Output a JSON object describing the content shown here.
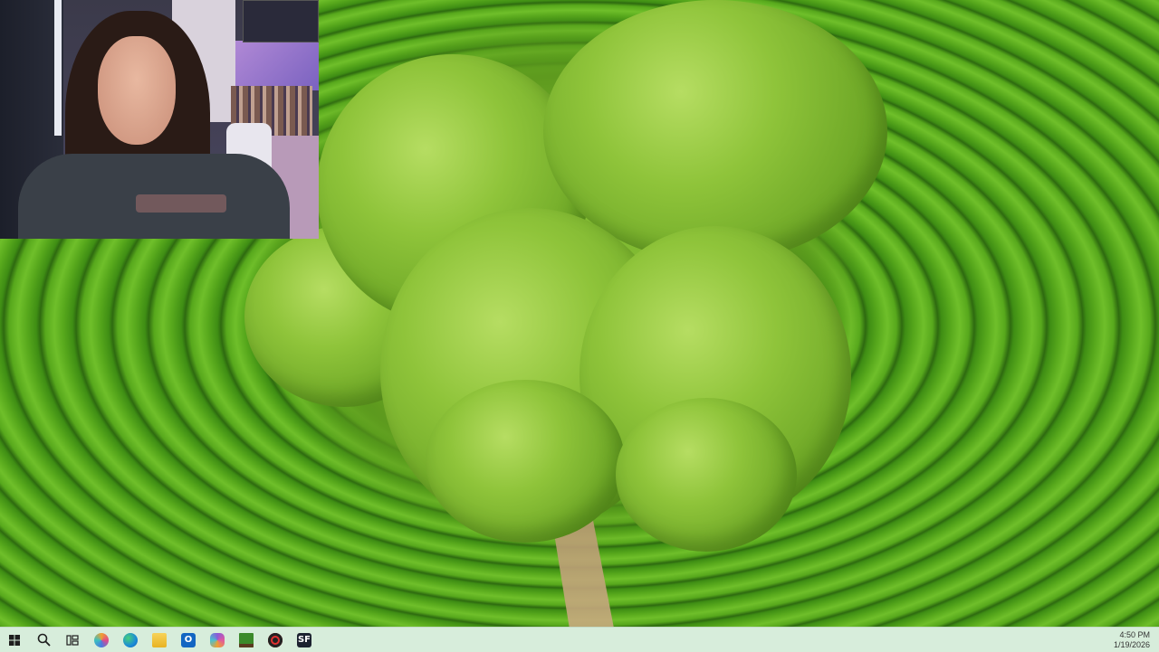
{
  "taskbar": {
    "time": "4:50 PM",
    "date": "1/19/2026",
    "apps": [
      {
        "name": "copilot",
        "color": "#f0a030"
      },
      {
        "name": "edge",
        "color": "#1a8ad8"
      },
      {
        "name": "file-explorer",
        "color": "#f2c12e"
      },
      {
        "name": "outlook",
        "color": "#1266c2"
      },
      {
        "name": "copilot-alt",
        "color": "#8a5ad8"
      },
      {
        "name": "minecraft",
        "color": "#3b8a2a"
      },
      {
        "name": "obs",
        "color": "#222222"
      },
      {
        "name": "sf-app",
        "color": "#1c2230",
        "label": "SF"
      }
    ]
  },
  "colors": {
    "taskbar_bg": "#d7eddb",
    "windows_logo": "#1e1e1e",
    "wallpaper_green": "#57a81c"
  }
}
